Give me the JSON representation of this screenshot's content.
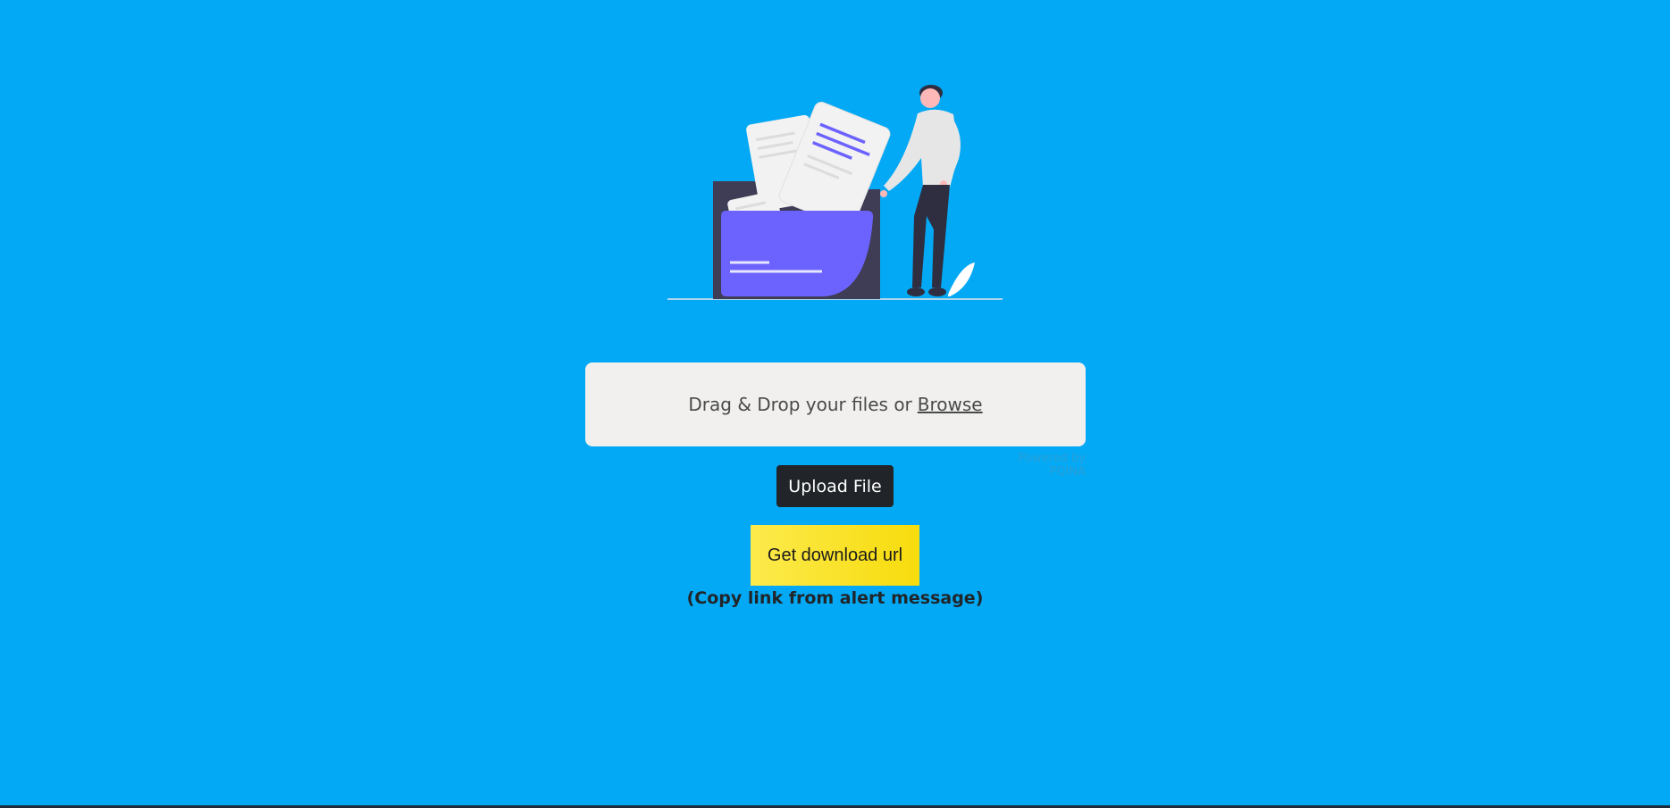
{
  "dropzone": {
    "text": "Drag & Drop your files or",
    "browse_label": "Browse"
  },
  "powered_by": "Powered by PQINA",
  "buttons": {
    "upload": "Upload File",
    "get_url": "Get download url"
  },
  "hint": "(Copy link from alert message)",
  "illustration": {
    "name": "file-upload-illustration",
    "colors": {
      "folder": "#6c63ff",
      "folder_back": "#3f3d56",
      "paper": "#f2f2f2",
      "person_pants": "#2f2e41"
    }
  },
  "theme": {
    "background": "#03a9f4",
    "dropzone_bg": "#f1f0ef",
    "upload_button": "#212529",
    "download_button": "#f7dc0d"
  }
}
